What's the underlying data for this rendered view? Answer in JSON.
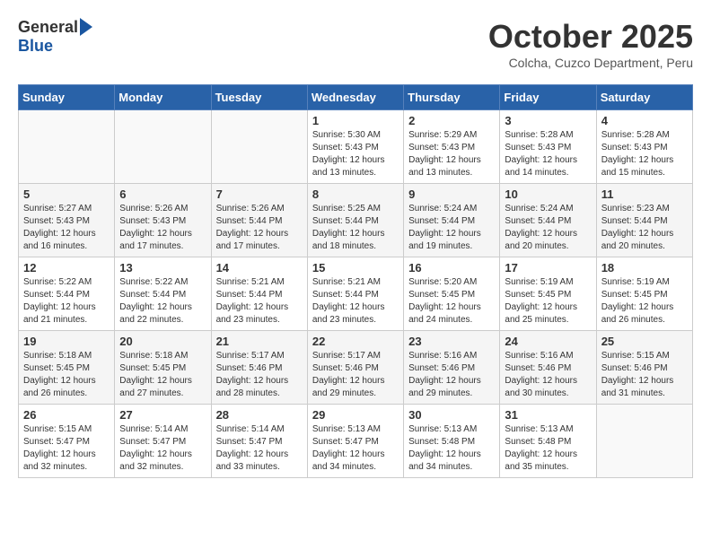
{
  "header": {
    "logo_general": "General",
    "logo_blue": "Blue",
    "month_title": "October 2025",
    "location": "Colcha, Cuzco Department, Peru"
  },
  "days_of_week": [
    "Sunday",
    "Monday",
    "Tuesday",
    "Wednesday",
    "Thursday",
    "Friday",
    "Saturday"
  ],
  "weeks": [
    [
      {
        "day": "",
        "info": ""
      },
      {
        "day": "",
        "info": ""
      },
      {
        "day": "",
        "info": ""
      },
      {
        "day": "1",
        "info": "Sunrise: 5:30 AM\nSunset: 5:43 PM\nDaylight: 12 hours\nand 13 minutes."
      },
      {
        "day": "2",
        "info": "Sunrise: 5:29 AM\nSunset: 5:43 PM\nDaylight: 12 hours\nand 13 minutes."
      },
      {
        "day": "3",
        "info": "Sunrise: 5:28 AM\nSunset: 5:43 PM\nDaylight: 12 hours\nand 14 minutes."
      },
      {
        "day": "4",
        "info": "Sunrise: 5:28 AM\nSunset: 5:43 PM\nDaylight: 12 hours\nand 15 minutes."
      }
    ],
    [
      {
        "day": "5",
        "info": "Sunrise: 5:27 AM\nSunset: 5:43 PM\nDaylight: 12 hours\nand 16 minutes."
      },
      {
        "day": "6",
        "info": "Sunrise: 5:26 AM\nSunset: 5:43 PM\nDaylight: 12 hours\nand 17 minutes."
      },
      {
        "day": "7",
        "info": "Sunrise: 5:26 AM\nSunset: 5:44 PM\nDaylight: 12 hours\nand 17 minutes."
      },
      {
        "day": "8",
        "info": "Sunrise: 5:25 AM\nSunset: 5:44 PM\nDaylight: 12 hours\nand 18 minutes."
      },
      {
        "day": "9",
        "info": "Sunrise: 5:24 AM\nSunset: 5:44 PM\nDaylight: 12 hours\nand 19 minutes."
      },
      {
        "day": "10",
        "info": "Sunrise: 5:24 AM\nSunset: 5:44 PM\nDaylight: 12 hours\nand 20 minutes."
      },
      {
        "day": "11",
        "info": "Sunrise: 5:23 AM\nSunset: 5:44 PM\nDaylight: 12 hours\nand 20 minutes."
      }
    ],
    [
      {
        "day": "12",
        "info": "Sunrise: 5:22 AM\nSunset: 5:44 PM\nDaylight: 12 hours\nand 21 minutes."
      },
      {
        "day": "13",
        "info": "Sunrise: 5:22 AM\nSunset: 5:44 PM\nDaylight: 12 hours\nand 22 minutes."
      },
      {
        "day": "14",
        "info": "Sunrise: 5:21 AM\nSunset: 5:44 PM\nDaylight: 12 hours\nand 23 minutes."
      },
      {
        "day": "15",
        "info": "Sunrise: 5:21 AM\nSunset: 5:44 PM\nDaylight: 12 hours\nand 23 minutes."
      },
      {
        "day": "16",
        "info": "Sunrise: 5:20 AM\nSunset: 5:45 PM\nDaylight: 12 hours\nand 24 minutes."
      },
      {
        "day": "17",
        "info": "Sunrise: 5:19 AM\nSunset: 5:45 PM\nDaylight: 12 hours\nand 25 minutes."
      },
      {
        "day": "18",
        "info": "Sunrise: 5:19 AM\nSunset: 5:45 PM\nDaylight: 12 hours\nand 26 minutes."
      }
    ],
    [
      {
        "day": "19",
        "info": "Sunrise: 5:18 AM\nSunset: 5:45 PM\nDaylight: 12 hours\nand 26 minutes."
      },
      {
        "day": "20",
        "info": "Sunrise: 5:18 AM\nSunset: 5:45 PM\nDaylight: 12 hours\nand 27 minutes."
      },
      {
        "day": "21",
        "info": "Sunrise: 5:17 AM\nSunset: 5:46 PM\nDaylight: 12 hours\nand 28 minutes."
      },
      {
        "day": "22",
        "info": "Sunrise: 5:17 AM\nSunset: 5:46 PM\nDaylight: 12 hours\nand 29 minutes."
      },
      {
        "day": "23",
        "info": "Sunrise: 5:16 AM\nSunset: 5:46 PM\nDaylight: 12 hours\nand 29 minutes."
      },
      {
        "day": "24",
        "info": "Sunrise: 5:16 AM\nSunset: 5:46 PM\nDaylight: 12 hours\nand 30 minutes."
      },
      {
        "day": "25",
        "info": "Sunrise: 5:15 AM\nSunset: 5:46 PM\nDaylight: 12 hours\nand 31 minutes."
      }
    ],
    [
      {
        "day": "26",
        "info": "Sunrise: 5:15 AM\nSunset: 5:47 PM\nDaylight: 12 hours\nand 32 minutes."
      },
      {
        "day": "27",
        "info": "Sunrise: 5:14 AM\nSunset: 5:47 PM\nDaylight: 12 hours\nand 32 minutes."
      },
      {
        "day": "28",
        "info": "Sunrise: 5:14 AM\nSunset: 5:47 PM\nDaylight: 12 hours\nand 33 minutes."
      },
      {
        "day": "29",
        "info": "Sunrise: 5:13 AM\nSunset: 5:47 PM\nDaylight: 12 hours\nand 34 minutes."
      },
      {
        "day": "30",
        "info": "Sunrise: 5:13 AM\nSunset: 5:48 PM\nDaylight: 12 hours\nand 34 minutes."
      },
      {
        "day": "31",
        "info": "Sunrise: 5:13 AM\nSunset: 5:48 PM\nDaylight: 12 hours\nand 35 minutes."
      },
      {
        "day": "",
        "info": ""
      }
    ]
  ]
}
